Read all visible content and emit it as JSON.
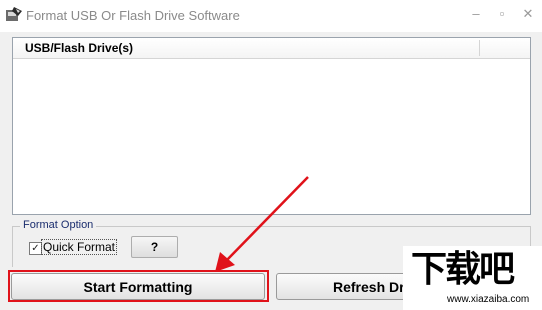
{
  "window": {
    "title": "Format USB Or Flash Drive Software",
    "icon": "usb-app-icon",
    "controls": {
      "minimize": "–",
      "maximize": "▫",
      "close": "✕"
    }
  },
  "drive_list": {
    "column_header": "USB/Flash Drive(s)",
    "items": []
  },
  "format_option": {
    "group_label": "Format Option",
    "quick_format_label": "Quick Format",
    "quick_format_checked": true,
    "check_glyph": "✓",
    "help_label": "?"
  },
  "buttons": {
    "start_label": "Start Formatting",
    "refresh_label": "Refresh Drive List"
  },
  "annotation": {
    "highlight_color": "#e0121a"
  },
  "watermark": {
    "logo": "下载吧",
    "url": "www.xiazaiba.com"
  }
}
